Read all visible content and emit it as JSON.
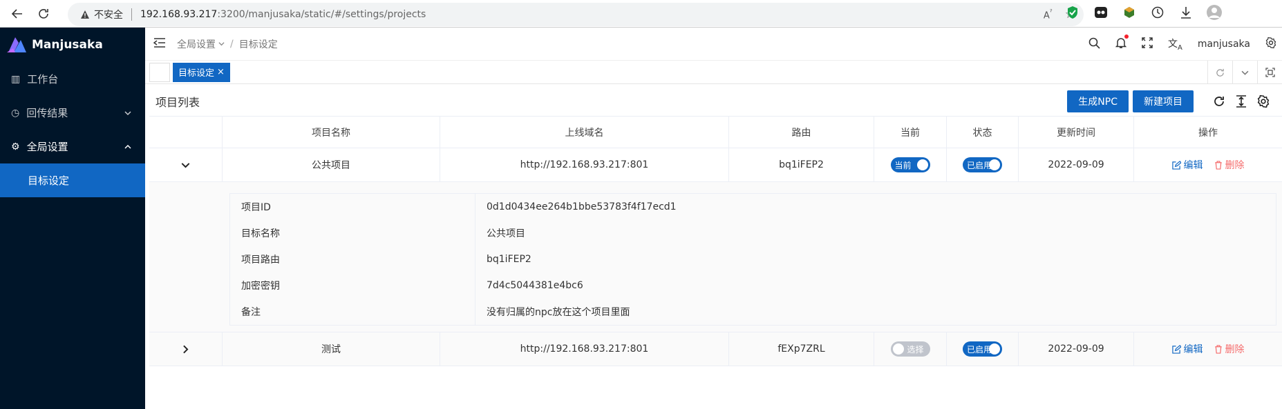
{
  "browser": {
    "security_label": "不安全",
    "url_host": "192.168.93.217",
    "url_path": ":3200/manjusaka/static/#/settings/projects"
  },
  "sidebar": {
    "app_name": "Manjusaka",
    "items": [
      {
        "label": "工作台"
      },
      {
        "label": "回传结果"
      },
      {
        "label": "全局设置"
      },
      {
        "label": "目标设定"
      }
    ]
  },
  "topbar": {
    "breadcrumb_parent": "全局设置",
    "breadcrumb_sep": "/",
    "breadcrumb_current": "目标设定",
    "username": "manjusaka"
  },
  "tabs": {
    "active_tab": "目标设定",
    "close_glyph": "×"
  },
  "toolbar": {
    "title": "项目列表",
    "generate_npc": "生成NPC",
    "new_project": "新建项目"
  },
  "table": {
    "headers": [
      "项目名称",
      "上线域名",
      "路由",
      "当前",
      "状态",
      "更新时间",
      "操作"
    ],
    "rows": [
      {
        "name": "公共项目",
        "domain": "http://192.168.93.217:801",
        "route": "bq1iFEP2",
        "current": "当前",
        "status": "已启用",
        "updated": "2022-09-09",
        "edit": "编辑",
        "delete": "删除"
      },
      {
        "name": "测试",
        "domain": "http://192.168.93.217:801",
        "route": "fEXp7ZRL",
        "current": "选择",
        "status": "已启用",
        "updated": "2022-09-09",
        "edit": "编辑",
        "delete": "删除"
      }
    ],
    "detail": [
      {
        "label": "项目ID",
        "value": "0d1d0434ee264b1bbe53783f4f17ecd1"
      },
      {
        "label": "目标名称",
        "value": "公共项目"
      },
      {
        "label": "项目路由",
        "value": "bq1iFEP2"
      },
      {
        "label": "加密密钥",
        "value": "7d4c5044381e4bc6"
      },
      {
        "label": "备注",
        "value": "没有归属的npc放在这个项目里面"
      }
    ]
  },
  "colors": {
    "primary": "#1167c3",
    "sidebar_bg": "#001529",
    "danger": "#f56c6c"
  }
}
